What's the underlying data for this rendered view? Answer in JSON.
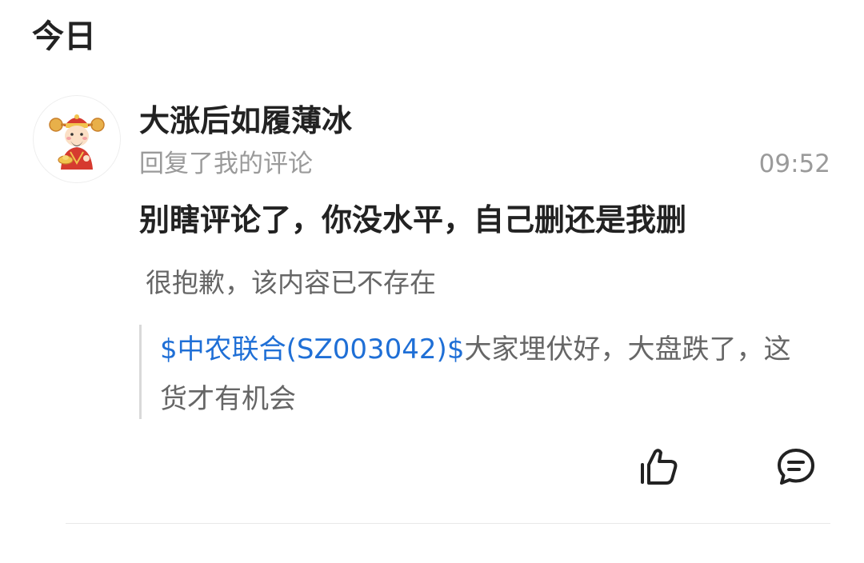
{
  "section": {
    "title": "今日"
  },
  "notification": {
    "user": {
      "name": "大涨后如履薄冰",
      "avatar_icon": "god-of-wealth-avatar"
    },
    "action": "回复了我的评论",
    "time": "09:52",
    "reply": "别瞎评论了，你没水平，自己删还是我删",
    "original_comment": "很抱歉，该内容已不存在",
    "quoted_post": {
      "stock_tag": "$中农联合(SZ003042)$",
      "text": "大家埋伏好，大盘跌了，这货才有机会"
    },
    "actions": {
      "like_icon": "thumbs-up-icon",
      "comment_icon": "comment-bubble-icon"
    }
  },
  "colors": {
    "link": "#1f6fd6",
    "muted": "#9a9a9a",
    "primary_text": "#222222"
  }
}
